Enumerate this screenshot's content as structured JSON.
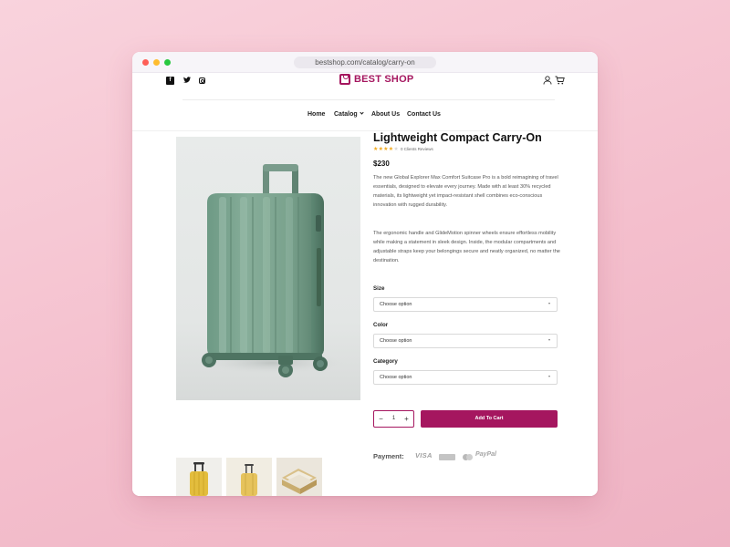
{
  "browser": {
    "url": "bestshop.com/catalog/carry-on"
  },
  "header": {
    "social_icons": [
      "facebook-icon",
      "twitter-icon",
      "instagram-icon"
    ],
    "logo_text": "BEST SHOP",
    "icons": [
      "user-icon",
      "cart-icon"
    ]
  },
  "nav": {
    "home": "Home",
    "catalog": "Catalog",
    "about": "About Us",
    "contact": "Contact Us"
  },
  "product": {
    "title": "Lightweight Compact Carry-On",
    "rating_stars": "★★★★",
    "rating_empty": "★",
    "rating": 4,
    "reviews": "0 Clients Reviews",
    "price": "$230",
    "description_1": "The new Global Explorer Max Comfort Suitcase Pro is a bold reimagining of travel essentials, designed to elevate every journey. Made with at least 30% recycled materials, its lightweight yet impact-resistant shell combines eco-conscious innovation with rugged durability.",
    "description_2": "The ergonomic handle and GlideMotion spinner wheels ensure effortless mobility while making a statement in sleek design. Inside, the modular compartments and adjustable straps keep your belongings secure and neatly organized, no matter the destination."
  },
  "options": {
    "size_label": "Size",
    "size_value": "Choose option",
    "color_label": "Color",
    "color_value": "Choose option",
    "category_label": "Category",
    "category_value": "Choose option"
  },
  "cart": {
    "minus": "−",
    "plus": "+",
    "quantity": "1",
    "add_label": "Add To Cart"
  },
  "payment": {
    "label": "Payment:",
    "visa": "VISA",
    "paypal": "PayPal",
    "methods": [
      "visa-icon",
      "amex-icon",
      "mastercard-icon",
      "paypal-icon"
    ]
  },
  "colors": {
    "brand": "#a5165f",
    "suitcase_main": "#7fa692",
    "background": "#f6c4d1"
  }
}
